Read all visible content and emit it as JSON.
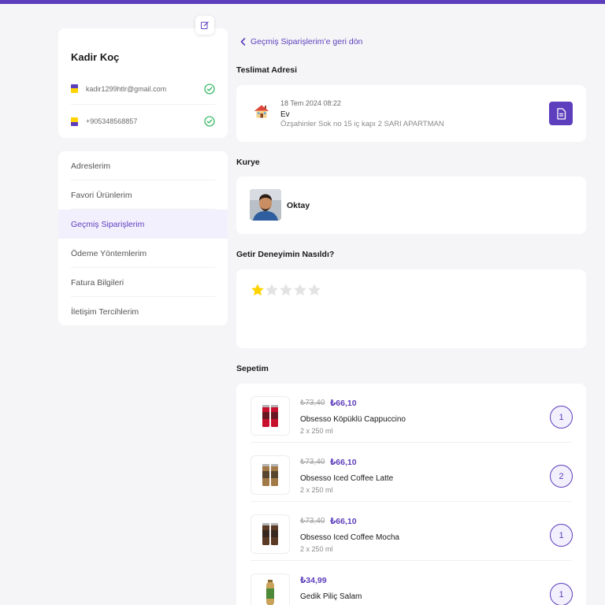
{
  "profile": {
    "name": "Kadir Koç",
    "email": "kadir1299htlr@gmail.com",
    "phone": "+905348568857"
  },
  "menu": {
    "items": [
      {
        "label": "Adreslerim"
      },
      {
        "label": "Favori Ürünlerim"
      },
      {
        "label": "Geçmiş Siparişlerim"
      },
      {
        "label": "Ödeme Yöntemlerim"
      },
      {
        "label": "Fatura Bilgileri"
      },
      {
        "label": "İletişim Tercihlerim"
      }
    ],
    "active": "Geçmiş Siparişlerim"
  },
  "back_link": "Geçmiş Siparişlerim’e geri dön",
  "delivery": {
    "title": "Teslimat Adresi",
    "date": "18 Tem 2024 08:22",
    "address_name": "Ev",
    "address_line": "Özşahinler Sok no 15 iç kapı 2 SARI APARTMAN"
  },
  "courier": {
    "title": "Kurye",
    "name": "Oktay"
  },
  "rating": {
    "title": "Getir Deneyimin Nasıldı?",
    "value": 1,
    "max": 5
  },
  "basket": {
    "title": "Sepetim",
    "items": [
      {
        "old_price": "₺73,40",
        "price": "₺66,10",
        "name": "Obsesso Köpüklü Cappuccino",
        "size": "2 x 250 ml",
        "qty": "1",
        "can_color": "#c8102e"
      },
      {
        "old_price": "₺73,40",
        "price": "₺66,10",
        "name": "Obsesso Iced Coffee Latte",
        "size": "2 x 250 ml",
        "qty": "2",
        "can_color": "#a27a47"
      },
      {
        "old_price": "₺73,40",
        "price": "₺66,10",
        "name": "Obsesso Iced Coffee Mocha",
        "size": "2 x 250 ml",
        "qty": "1",
        "can_color": "#5b3a26"
      },
      {
        "old_price": "",
        "price": "₺34,99",
        "name": "Gedik Piliç Salam",
        "size": "",
        "qty": "1",
        "can_color": "#c9a25a"
      }
    ]
  },
  "colors": {
    "brand": "#5d3ebc",
    "brand_light": "#f3f0fe",
    "star_active": "#ffd300",
    "check": "#2db55d"
  }
}
